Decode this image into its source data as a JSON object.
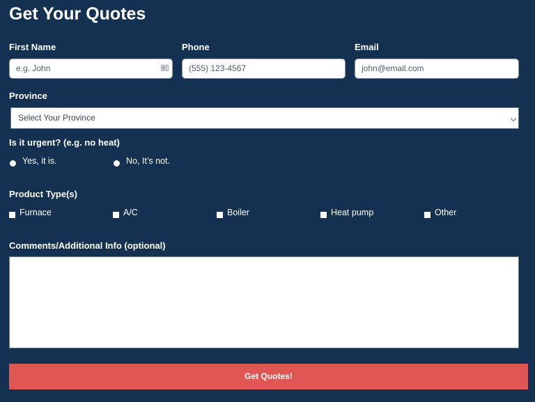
{
  "form": {
    "title": "Get Your Quotes",
    "first_name": {
      "label": "First Name",
      "placeholder": "e.g. John",
      "value": "",
      "icon": "contact-card-icon"
    },
    "phone": {
      "label": "Phone",
      "placeholder": "(555) 123-4567",
      "value": ""
    },
    "email": {
      "label": "Email",
      "placeholder": "john@email.com",
      "value": ""
    },
    "province": {
      "label": "Province",
      "selected": "Select Your Province",
      "icon": "chevron-down-icon"
    },
    "urgent": {
      "label": "Is it urgent? (e.g. no heat)",
      "options": [
        {
          "label": "Yes, it is.",
          "checked": false
        },
        {
          "label": "No, It’s not.",
          "checked": false
        }
      ]
    },
    "product_types": {
      "label": "Product Type(s)",
      "options": [
        {
          "label": "Furnace",
          "checked": false
        },
        {
          "label": "A/C",
          "checked": false
        },
        {
          "label": "Boiler",
          "checked": false
        },
        {
          "label": "Heat pump",
          "checked": false
        },
        {
          "label": "Other",
          "checked": false
        }
      ]
    },
    "comments": {
      "label": "Comments/Additional Info (optional)",
      "value": ""
    },
    "submit_label": "Get Quotes!"
  },
  "colors": {
    "background": "#143152",
    "accent_button": "#e05654",
    "text": "#ffffff"
  }
}
